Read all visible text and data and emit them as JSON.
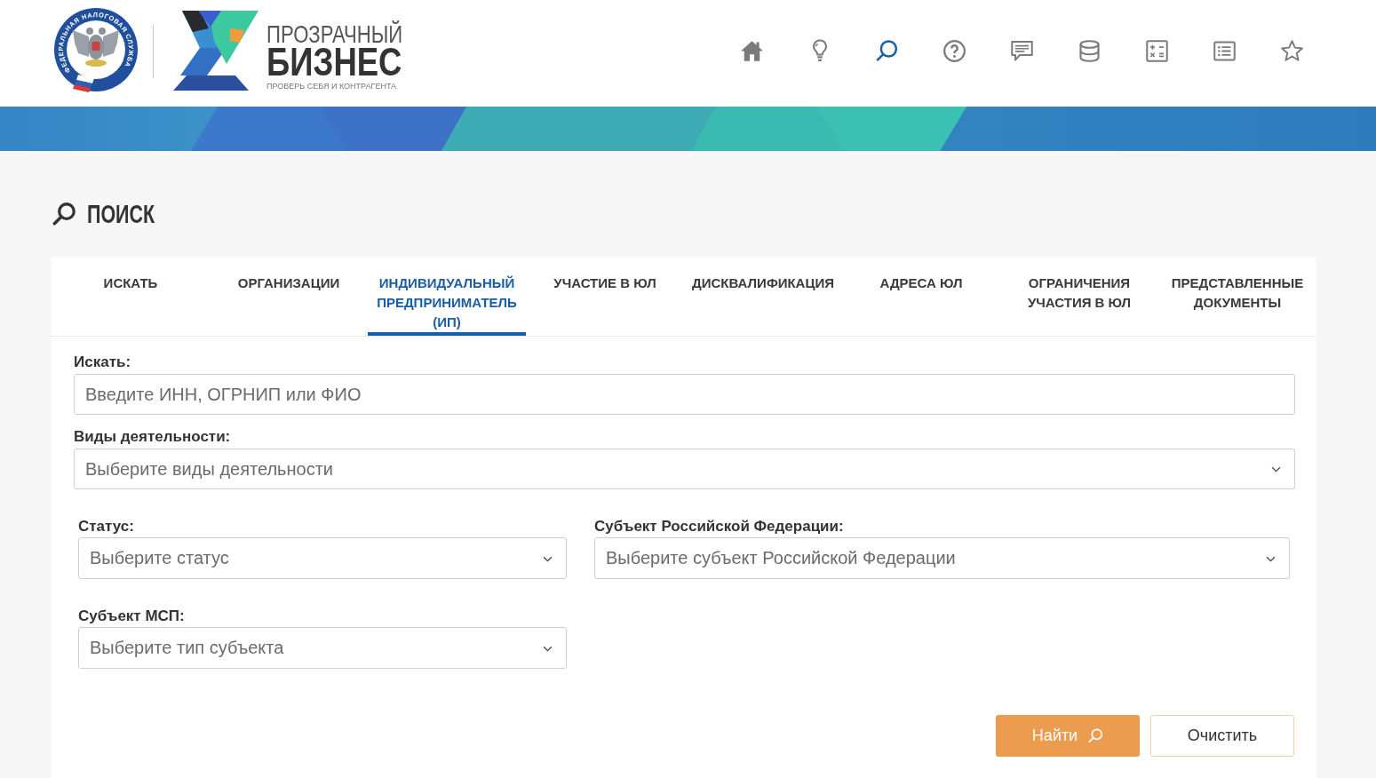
{
  "header": {
    "emblem_text": "ФЕДЕРАЛЬНАЯ НАЛОГОВАЯ СЛУЖБА",
    "brand": {
      "title": "ПРОЗРАЧНЫЙ",
      "name": "БИЗНЕС",
      "tagline": "ПРОВЕРЬ СЕБЯ И КОНТРАГЕНТА"
    },
    "nav_items": [
      {
        "selected": false
      },
      {
        "selected": false
      },
      {
        "selected": true
      },
      {
        "selected": false
      },
      {
        "selected": false
      },
      {
        "selected": false
      },
      {
        "selected": false
      },
      {
        "selected": false
      },
      {
        "selected": false
      }
    ]
  },
  "page_title": "ПОИСК",
  "tabs": [
    {
      "label": "ИСКАТЬ",
      "selected": false
    },
    {
      "label": "ОРГАНИЗАЦИИ",
      "selected": false
    },
    {
      "label": "ИНДИВИДУАЛЬНЫЙ\nПРЕДПРИНИМАТЕЛЬ\n(ИП)",
      "selected": true
    },
    {
      "label": "УЧАСТИЕ В ЮЛ",
      "selected": false
    },
    {
      "label": "ДИСКВАЛИФИКАЦИЯ",
      "selected": false
    },
    {
      "label": "АДРЕСА ЮЛ",
      "selected": false
    },
    {
      "label": "ОГРАНИЧЕНИЯ\nУЧАСТИЯ В ЮЛ",
      "selected": false
    },
    {
      "label": "ПРЕДСТАВЛЕННЫЕ\nДОКУМЕНТЫ",
      "selected": false
    }
  ],
  "form": {
    "fields": [
      {
        "label": "Искать:",
        "kind": "text",
        "placeholder": "Введите ИНН, ОГРНИП или ФИО"
      },
      {
        "label": "Виды деятельности:",
        "kind": "select",
        "placeholder": "Выберите виды деятельности"
      }
    ],
    "filters": [
      {
        "label": "Статус:",
        "kind": "select",
        "placeholder": "Выберите статус"
      },
      {
        "label": "Субъект Российской Федерации:",
        "kind": "select",
        "placeholder": "Выберите субъект Российской Федерации"
      },
      {
        "label": "Субъект МСП:",
        "kind": "select",
        "placeholder": "Выберите тип субъекта"
      }
    ]
  },
  "buttons": [
    {
      "label": "Найти",
      "kind": "primary"
    },
    {
      "label": "Очистить",
      "kind": "secondary"
    }
  ]
}
